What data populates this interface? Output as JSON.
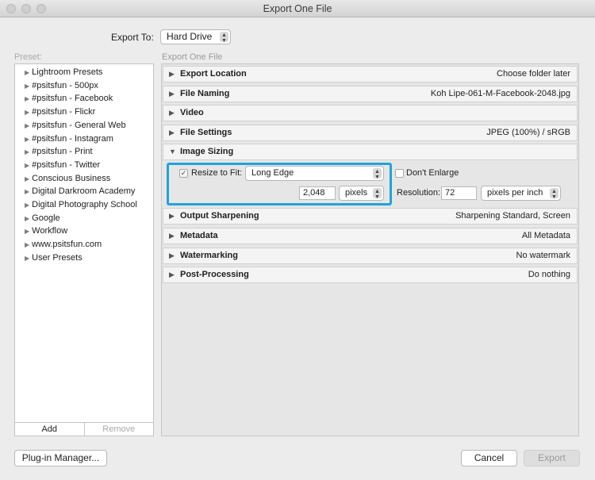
{
  "window": {
    "title": "Export One File"
  },
  "export_to": {
    "label": "Export To:",
    "value": "Hard Drive"
  },
  "presets": {
    "heading": "Preset:",
    "items": [
      "Lightroom Presets",
      "#psitsfun - 500px",
      "#psitsfun - Facebook",
      "#psitsfun - Flickr",
      "#psitsfun - General Web",
      "#psitsfun - Instagram",
      "#psitsfun - Print",
      "#psitsfun - Twitter",
      "Conscious Business",
      "Digital Darkroom Academy",
      "Digital Photography School",
      "Google",
      "Workflow",
      "www.psitsfun.com",
      "User Presets"
    ],
    "add_label": "Add",
    "remove_label": "Remove"
  },
  "export_panel": {
    "heading": "Export One File",
    "sections": [
      {
        "name": "Export Location",
        "summary": "Choose folder later",
        "expanded": false
      },
      {
        "name": "File Naming",
        "summary": "Koh Lipe-061-M-Facebook-2048.jpg",
        "expanded": false
      },
      {
        "name": "Video",
        "summary": "",
        "expanded": false
      },
      {
        "name": "File Settings",
        "summary": "JPEG (100%) / sRGB",
        "expanded": false
      },
      {
        "name": "Image Sizing",
        "summary": "",
        "expanded": true
      },
      {
        "name": "Output Sharpening",
        "summary": "Sharpening Standard, Screen",
        "expanded": false
      },
      {
        "name": "Metadata",
        "summary": "All Metadata",
        "expanded": false
      },
      {
        "name": "Watermarking",
        "summary": "No watermark",
        "expanded": false
      },
      {
        "name": "Post-Processing",
        "summary": "Do nothing",
        "expanded": false
      }
    ],
    "image_sizing": {
      "resize_label": "Resize to Fit:",
      "resize_checked": true,
      "resize_mode": "Long Edge",
      "dont_enlarge_label": "Don't Enlarge",
      "dont_enlarge_checked": false,
      "size_value": "2,048",
      "size_unit": "pixels",
      "resolution_label": "Resolution:",
      "resolution_value": "72",
      "resolution_unit": "pixels per inch"
    }
  },
  "footer": {
    "plugin_manager_label": "Plug-in Manager...",
    "cancel_label": "Cancel",
    "export_label": "Export"
  },
  "colors": {
    "highlight": "#1fa3dc"
  }
}
